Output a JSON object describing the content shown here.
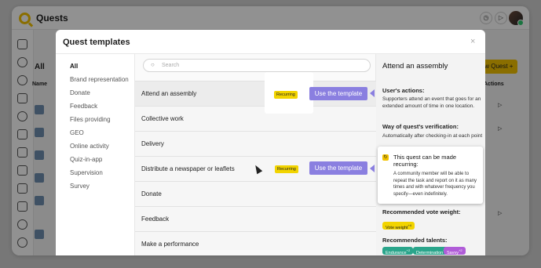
{
  "app": {
    "title": "Quests"
  },
  "background": {
    "page_title": "All",
    "column_name": "Name",
    "column_actions": "Actions",
    "new_quest_label": "New Quest +"
  },
  "modal": {
    "title": "Quest templates",
    "close": "×",
    "search_placeholder": "Search",
    "categories": [
      "All",
      "Brand representation",
      "Donate",
      "Feedback",
      "Files providing",
      "GEO",
      "Online activity",
      "Quiz-in-app",
      "Supervision",
      "Survey"
    ],
    "templates": [
      {
        "name": "Attend an assembly",
        "recurring": "Recurring",
        "use": "Use the template"
      },
      {
        "name": "Collective work"
      },
      {
        "name": "Delivery"
      },
      {
        "name": "Distribute a newspaper or leaflets",
        "recurring": "Recurring",
        "use": "Use the template"
      },
      {
        "name": "Donate"
      },
      {
        "name": "Feedback"
      },
      {
        "name": "Make a performance"
      }
    ]
  },
  "detail": {
    "title": "Attend an assembly",
    "users_actions_h": "User's actions:",
    "users_actions": "Supporters attend an event that goes for an extended amount of time in one location.",
    "verification_h": "Way of quest's verification:",
    "verification": "Automatically after checking-in at each point",
    "vote_weight_h": "Recommended vote weight:",
    "vote_weight_label": "Vote weight",
    "vote_weight_value": "+4",
    "talents_h": "Recommended talents:",
    "talents": [
      {
        "label": "Endurance",
        "value": "+2",
        "color": "#2aa58b"
      },
      {
        "label": "Determination",
        "value": "+2",
        "color": "#2aa58b"
      },
      {
        "label": "Savvy",
        "value": "+2",
        "color": "#b05cd8"
      }
    ]
  },
  "callout": {
    "title": "This quest can be made recurring:",
    "body": "A community member will be able to repeat the task and report on it as many times and with whatever frequency you specify—even indefinitely."
  }
}
